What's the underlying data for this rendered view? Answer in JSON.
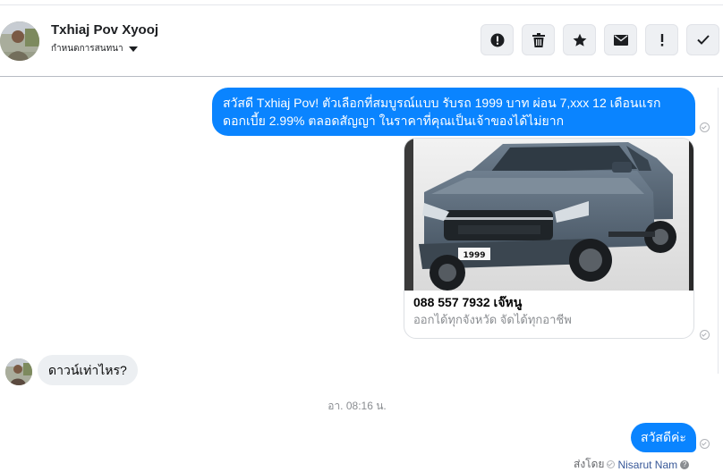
{
  "header": {
    "contact_name": "Txhiaj Pov Xyooj",
    "assign_label": "กำหนดการสนทนา",
    "actions": [
      {
        "icon": "alert-circle-icon",
        "name": "mark-spam-button"
      },
      {
        "icon": "trash-icon",
        "name": "delete-button"
      },
      {
        "icon": "star-icon",
        "name": "star-button"
      },
      {
        "icon": "envelope-icon",
        "name": "mark-unread-button"
      },
      {
        "icon": "exclamation-icon",
        "name": "follow-up-button"
      },
      {
        "icon": "check-icon",
        "name": "mark-done-button"
      }
    ]
  },
  "messages": {
    "outgoing_1_line1": "สวัสดี Txhiaj Pov! ตัวเลือกที่สมบูรณ์แบบ รับรถ 1999 บาท ผ่อน 7,xxx 12 เดือนแรก",
    "outgoing_1_line2": "ดอกเบี้ย 2.99% ตลอดสัญญา ในราคาที่คุณเป็นเจ้าของได้ไม่ยาก",
    "card": {
      "title": "088 557 7932 เจ๊หนู",
      "subtitle": "ออกได้ทุกจังหวัด จัดได้ทุกอาชีพ",
      "image": "pickup-truck-photo",
      "plate_text": "1999"
    },
    "incoming_1": "ดาวน์เท่าไหร?",
    "timestamp": "อา. 08:16 น.",
    "outgoing_2": "สวัสดีค่ะ",
    "sent_by_label": "ส่งโดย",
    "sent_by_name": "Nisarut Nam",
    "help_mark": "?"
  },
  "colors": {
    "outgoing_bubble": "#0a84ff",
    "incoming_bubble": "#eceff2",
    "muted_text": "#8a8d91"
  }
}
